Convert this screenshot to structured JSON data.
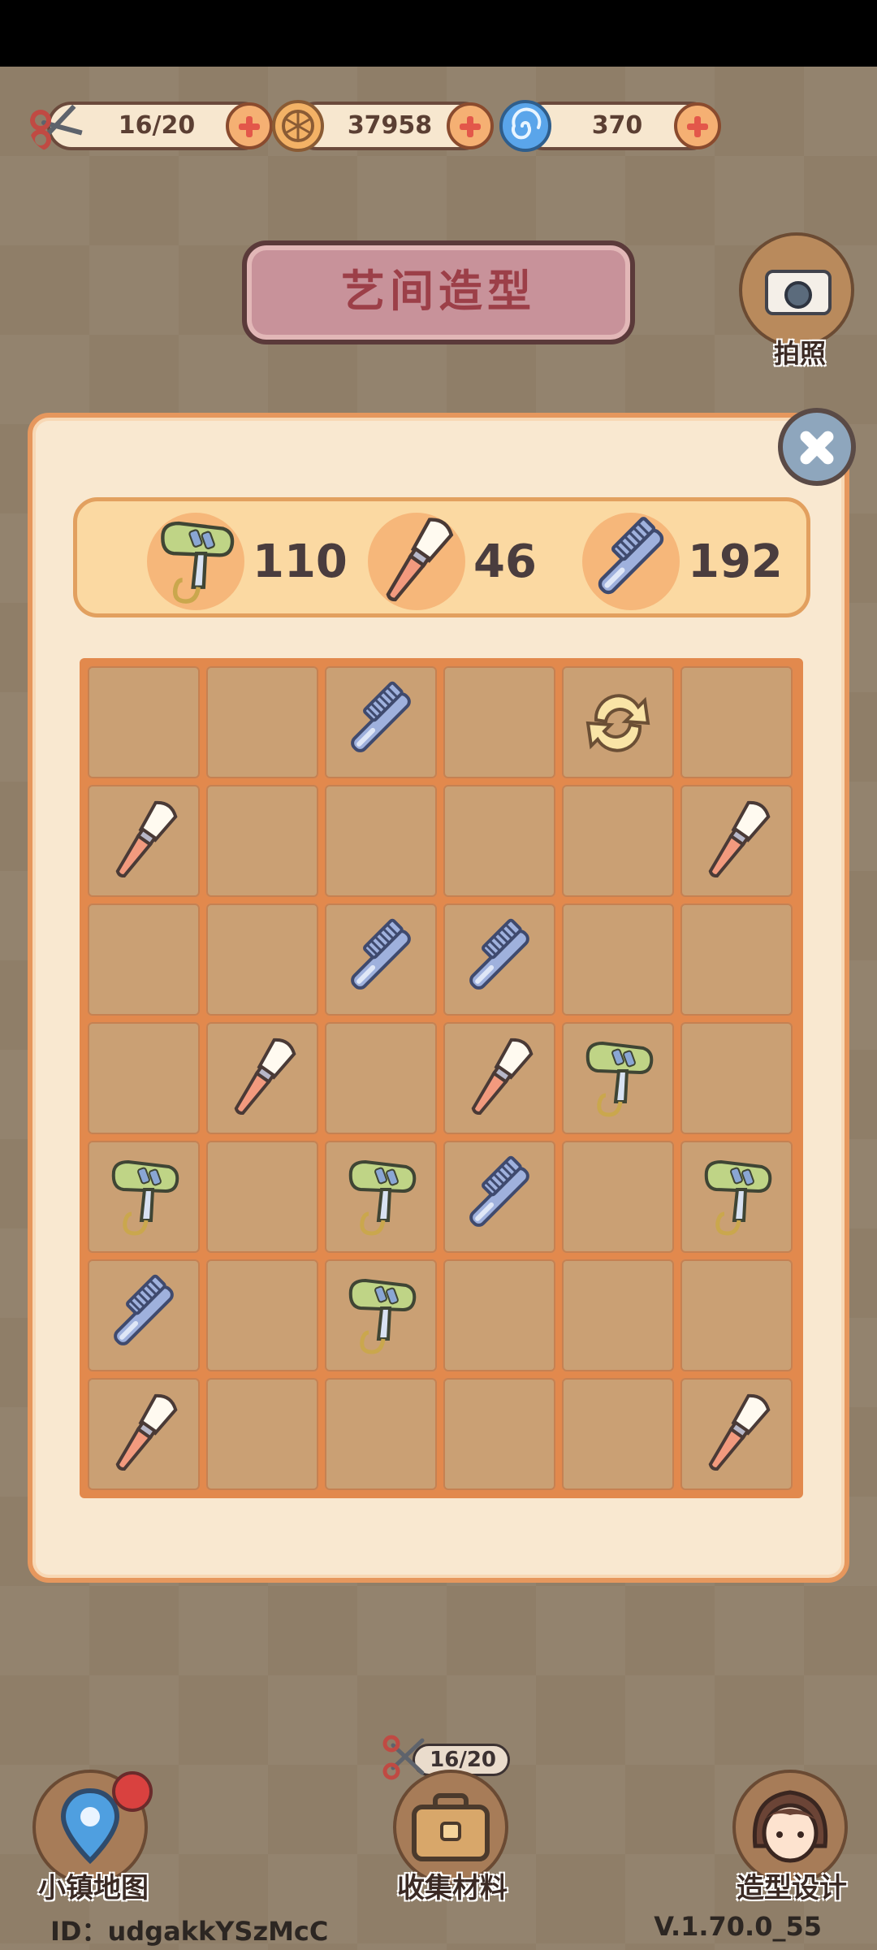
{
  "resources": {
    "energy": {
      "value": "16/20",
      "icon": "scissors-icon"
    },
    "coins": {
      "value": "37958",
      "icon": "coin-icon"
    },
    "gems": {
      "value": "370",
      "icon": "swirl-gem-icon"
    }
  },
  "title": "艺间造型",
  "camera_label": "拍照",
  "counts": [
    {
      "icon": "hair-dryer-icon",
      "value": "110"
    },
    {
      "icon": "makeup-brush-icon",
      "value": "46"
    },
    {
      "icon": "comb-icon",
      "value": "192"
    }
  ],
  "board": {
    "columns": 6,
    "rows": 7,
    "cells": [
      [
        "",
        "",
        "comb",
        "",
        "refresh",
        ""
      ],
      [
        "brush",
        "",
        "",
        "",
        "",
        "brush"
      ],
      [
        "",
        "",
        "comb",
        "comb",
        "",
        ""
      ],
      [
        "",
        "brush",
        "",
        "brush",
        "dryer",
        ""
      ],
      [
        "dryer",
        "",
        "dryer",
        "comb",
        "",
        "dryer"
      ],
      [
        "comb",
        "",
        "dryer",
        "",
        "",
        ""
      ],
      [
        "brush",
        "",
        "",
        "",
        "",
        "brush"
      ]
    ]
  },
  "bottom_nav": {
    "map": "小镇地图",
    "collect": "收集材料",
    "design": "造型设计",
    "collect_energy": "16/20"
  },
  "footer": {
    "id": "ID：udgakkYSzMcC",
    "version": "V.1.70.0_55"
  },
  "colors": {
    "panel_bg": "#f9e8d0",
    "board_border": "#e2894d",
    "cell": "#caa074",
    "accent_plus": "#f5b073"
  }
}
